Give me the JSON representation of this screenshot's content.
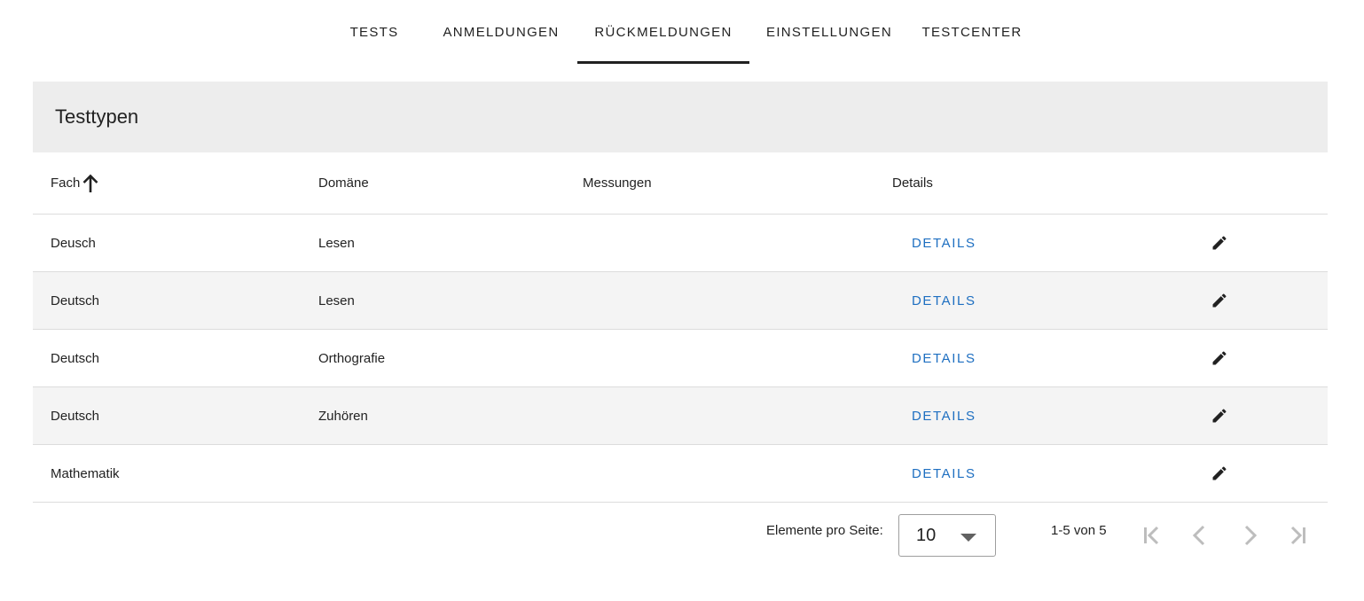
{
  "tabs": [
    {
      "label": "TESTS",
      "active": false
    },
    {
      "label": "ANMELDUNGEN",
      "active": false
    },
    {
      "label": "RÜCKMELDUNGEN",
      "active": true
    },
    {
      "label": "EINSTELLUNGEN",
      "active": false
    },
    {
      "label": "TESTCENTER",
      "active": false
    }
  ],
  "card": {
    "title": "Testtypen"
  },
  "table": {
    "columns": [
      {
        "label": "Fach",
        "sorted": "ascending",
        "sort_icon": "arrow-up-icon"
      },
      {
        "label": "Domäne"
      },
      {
        "label": "Messungen"
      },
      {
        "label": "Details"
      }
    ],
    "rows": [
      {
        "fach": "Deusch",
        "domaene": "Lesen",
        "messungen": "",
        "details": "DETAILS"
      },
      {
        "fach": "Deutsch",
        "domaene": "Lesen",
        "messungen": "",
        "details": "DETAILS"
      },
      {
        "fach": "Deutsch",
        "domaene": "Orthografie",
        "messungen": "",
        "details": "DETAILS"
      },
      {
        "fach": "Deutsch",
        "domaene": "Zuhören",
        "messungen": "",
        "details": "DETAILS"
      },
      {
        "fach": "Mathematik",
        "domaene": "",
        "messungen": "",
        "details": "DETAILS"
      }
    ],
    "row_action_icon": "pencil-icon"
  },
  "paginator": {
    "items_per_page_label": "Elemente pro Seite:",
    "page_size": "10",
    "range_label": "1-5 von 5",
    "buttons": [
      "first-page-icon",
      "previous-page-icon",
      "next-page-icon",
      "last-page-icon"
    ]
  },
  "colors": {
    "accent_link": "#1e6fc1",
    "header_bg": "#ededed",
    "alt_row_bg": "#f4f4f4",
    "active_tab_indicator": "#212121",
    "disabled_icon": "#bdbdbd"
  }
}
